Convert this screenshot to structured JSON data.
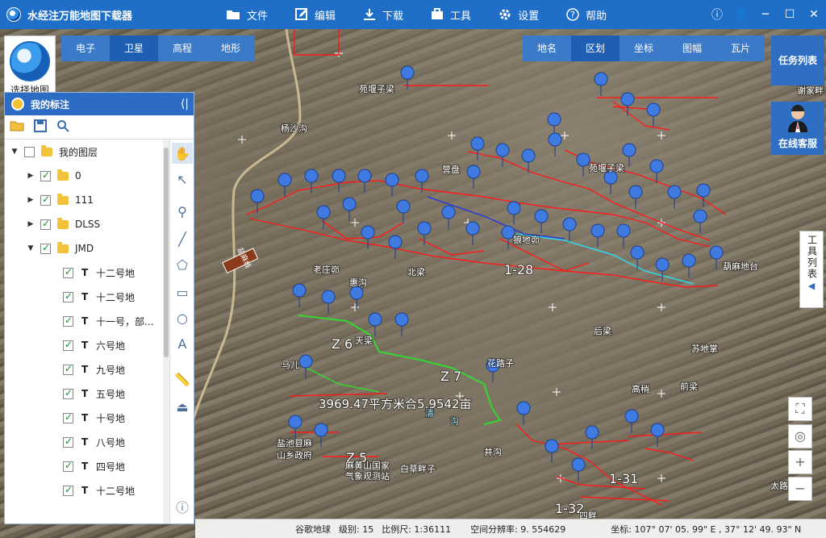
{
  "app": {
    "title": "水经注万能地图下载器"
  },
  "menu": [
    {
      "label": "文件",
      "icon": "folder-icon"
    },
    {
      "label": "编辑",
      "icon": "edit-icon"
    },
    {
      "label": "下载",
      "icon": "download-icon"
    },
    {
      "label": "工具",
      "icon": "toolbox-icon"
    },
    {
      "label": "设置",
      "icon": "gear-icon"
    },
    {
      "label": "帮助",
      "icon": "help-icon"
    }
  ],
  "basemap": {
    "label": "选择地图"
  },
  "map_types": [
    "电子",
    "卫星",
    "高程",
    "地形"
  ],
  "map_types_active": "卫星",
  "overlay_tabs": [
    "地名",
    "区划",
    "坐标",
    "图幅",
    "瓦片"
  ],
  "overlay_active": "区划",
  "side_buttons": {
    "tasks": "任务列表",
    "service": "在线客服"
  },
  "panel": {
    "title": "我的标注",
    "tree": [
      {
        "label": "我的图层",
        "level": 0,
        "type": "folder",
        "expanded": true,
        "checked": false
      },
      {
        "label": "0",
        "level": 1,
        "type": "folder",
        "expanded": false,
        "checked": true
      },
      {
        "label": "111",
        "level": 1,
        "type": "folder",
        "expanded": false,
        "checked": true
      },
      {
        "label": "DLSS",
        "level": 1,
        "type": "folder",
        "expanded": false,
        "checked": true
      },
      {
        "label": "JMD",
        "level": 1,
        "type": "folder",
        "expanded": true,
        "checked": true
      },
      {
        "label": "十二号地",
        "level": 2,
        "type": "text",
        "checked": true
      },
      {
        "label": "十二号地",
        "level": 2,
        "type": "text",
        "checked": true
      },
      {
        "label": "十一号，部...",
        "level": 2,
        "type": "text",
        "checked": true
      },
      {
        "label": "六号地",
        "level": 2,
        "type": "text",
        "checked": true
      },
      {
        "label": "九号地",
        "level": 2,
        "type": "text",
        "checked": true
      },
      {
        "label": "五号地",
        "level": 2,
        "type": "text",
        "checked": true
      },
      {
        "label": "十号地",
        "level": 2,
        "type": "text",
        "checked": true
      },
      {
        "label": "八号地",
        "level": 2,
        "type": "text",
        "checked": true
      },
      {
        "label": "四号地",
        "level": 2,
        "type": "text",
        "checked": true
      },
      {
        "label": "十二号地",
        "level": 2,
        "type": "text",
        "checked": true
      }
    ]
  },
  "toolbox": {
    "label": "工具列表"
  },
  "map_labels": [
    {
      "text": "苑堰子梁"
    },
    {
      "text": "杨沙沟"
    },
    {
      "text": "谢家畔"
    },
    {
      "text": "营盘"
    },
    {
      "text": "苑堰子梁"
    },
    {
      "text": "狼地峁"
    },
    {
      "text": "葫麻地台"
    },
    {
      "text": "老庄峁"
    },
    {
      "text": "惠沟"
    },
    {
      "text": "北梁"
    },
    {
      "text": "1-28"
    },
    {
      "text": "后梁"
    },
    {
      "text": "苏地掌"
    },
    {
      "text": "花路子"
    },
    {
      "text": "马儿"
    },
    {
      "text": "高稍"
    },
    {
      "text": "前梁"
    },
    {
      "text": "Z 6"
    },
    {
      "text": "Z 7"
    },
    {
      "text": "天梁"
    },
    {
      "text": "3969.47平方米合5.9542亩"
    },
    {
      "text": "清"
    },
    {
      "text": "沟"
    },
    {
      "text": "井沟"
    },
    {
      "text": "盐池县麻"
    },
    {
      "text": "山乡政府"
    },
    {
      "text": "Z 5"
    },
    {
      "text": "麻黄山国家"
    },
    {
      "text": "气象观测站"
    },
    {
      "text": "白草畔子"
    },
    {
      "text": "1-31"
    },
    {
      "text": "1-32"
    },
    {
      "text": "四畔"
    },
    {
      "text": "太路"
    },
    {
      "text": "盐麻线"
    }
  ],
  "status": {
    "source": "谷歌地球",
    "level": "级别: 15",
    "scale": "比例尺: 1:36111",
    "resolution": "空间分辨率: 9. 554629",
    "coord": "坐标: 107° 07' 05. 99\" E , 37° 12' 49. 93\" N"
  },
  "colors": {
    "title_bar": "#1f6fc9",
    "tab": "#3b79c9",
    "tab_active": "#1e5fb4",
    "boundary": "#ff1a1a",
    "green_line": "#34d62f",
    "marker": "#3f7ae0"
  }
}
